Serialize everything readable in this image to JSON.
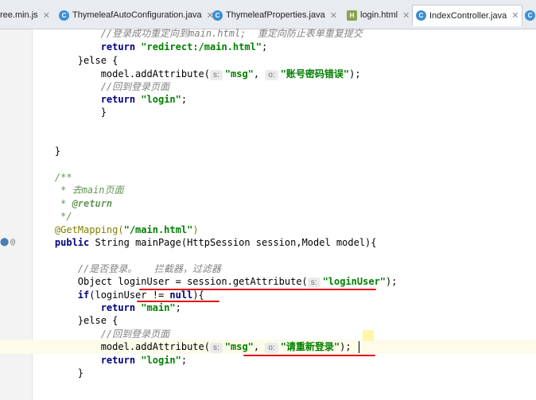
{
  "tabs": [
    {
      "label": "ree.min.js",
      "icon": "js-file-icon",
      "active": false
    },
    {
      "label": "ThymeleafAutoConfiguration.java",
      "icon": "java-class-icon",
      "active": false
    },
    {
      "label": "ThymeleafProperties.java",
      "icon": "java-class-icon",
      "active": false
    },
    {
      "label": "login.html",
      "icon": "html-file-icon",
      "active": false
    },
    {
      "label": "IndexController.java",
      "icon": "java-class-icon",
      "active": true
    }
  ],
  "code": {
    "l1": {
      "text": "//登录成功重定向到main.html;  重定向防止表单重复提交"
    },
    "l2": {
      "kw": "return",
      "str": "\"redirect:/main.html\"",
      "end": ";"
    },
    "l3": {
      "text": "}else {"
    },
    "l4": {
      "a": "model.addAttribute(",
      "h1": "s:",
      "s1": "\"msg\"",
      "sep": ", ",
      "h2": "o:",
      "s2": "\"账号密码错误\"",
      "end": ");"
    },
    "l5": {
      "text": "//回到登录页面"
    },
    "l6": {
      "kw": "return",
      "str": "\"login\"",
      "end": ";"
    },
    "l7": {
      "text": "}"
    },
    "l8": {
      "text": "}"
    },
    "l9": {
      "text": "/**"
    },
    "l10": {
      "star": "* ",
      "text": "去main页面"
    },
    "l11": {
      "star": "* ",
      "tag": "@return"
    },
    "l12": {
      "text": "*/"
    },
    "l13": {
      "ann": "@GetMapping(",
      "str": "\"/main.html\"",
      "end": ")"
    },
    "l14": {
      "kw": "public",
      "text": " String mainPage(HttpSession session,Model model){"
    },
    "l15": {
      "text": "//是否登录。   拦截器，过滤器"
    },
    "l16": {
      "a": "Object loginUser = session.getAttribute(",
      "h": "s:",
      "str": "\"loginUser\"",
      "end": ");"
    },
    "l17": {
      "kw": "if",
      "a": "(loginUser != ",
      "kw2": "null",
      "end": "){"
    },
    "l18": {
      "kw": "return",
      "str": "\"main\"",
      "end": ";"
    },
    "l19": {
      "text": "}else {"
    },
    "l20": {
      "text": "//回到登录页面"
    },
    "l21": {
      "a": "model.addAttribute(",
      "h1": "s:",
      "s1": "\"msg\"",
      "sep": ", ",
      "h2": "o:",
      "s2": "\"请重新登录\"",
      "end": ");"
    },
    "l22": {
      "kw": "return",
      "str": "\"login\"",
      "end": ";"
    },
    "l23": {
      "text": "}"
    }
  },
  "gutter": {
    "method_icon": "implemented-method-icon",
    "annotation_icon": "at-sign-icon"
  }
}
